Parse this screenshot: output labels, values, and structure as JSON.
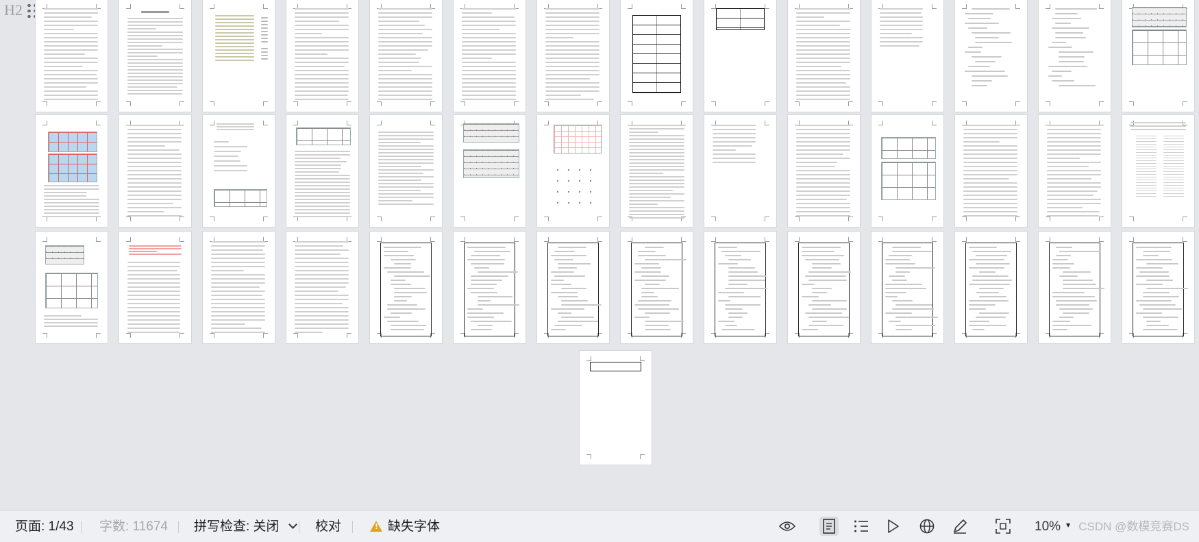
{
  "app": {
    "view": "multi-page thumbnail view",
    "canvas_color": "#e4e6e9"
  },
  "toolbar_left": {
    "heading_tool_label": "H2",
    "heading_tool_icon": "h2-icon",
    "grid_tool_icon": "drag-grid-icon"
  },
  "document": {
    "page_count": 43,
    "rows": [
      {
        "pages": [
          "text",
          "title-text",
          "toc",
          "text",
          "text",
          "text",
          "text",
          "table",
          "table-small",
          "text",
          "text-sparse",
          "code-sparse",
          "code-sparse",
          "mesh-figure"
        ]
      },
      {
        "pages": [
          "grid-figure",
          "text",
          "equations-figure",
          "figure-text",
          "equation-text",
          "mesh-figure-2",
          "plot-figure",
          "text-dense",
          "text-sparse",
          "text",
          "maze-figure",
          "text",
          "text",
          "table-list"
        ]
      },
      {
        "pages": [
          "mesh-figure-3",
          "red-text",
          "text",
          "text",
          "framed-code",
          "framed-code",
          "framed-code",
          "framed-code",
          "framed-code",
          "framed-code",
          "framed-code",
          "framed-code",
          "framed-code",
          "framed-code"
        ]
      },
      {
        "pages": [
          "framed-last"
        ]
      }
    ]
  },
  "status_bar": {
    "page_label": "页面: 1/43",
    "word_count_label": "字数: 11674",
    "spell_check_label": "拼写检查: 关闭",
    "proofread_label": "校对",
    "missing_font_label": "缺失字体",
    "zoom_label": "10%",
    "icons": [
      "eye-icon",
      "page-view-icon",
      "outline-view-icon",
      "play-icon",
      "globe-icon",
      "pen-icon",
      "fit-screen-icon"
    ],
    "active_view": "page-view-icon",
    "warning_color": "#e8a018"
  },
  "watermark": "CSDN @数模竞赛DS"
}
